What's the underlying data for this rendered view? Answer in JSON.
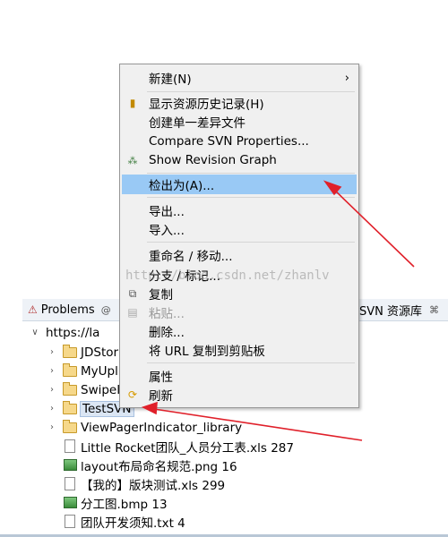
{
  "context_menu": {
    "items": [
      {
        "label": "新建(N)",
        "submenu": true
      },
      {
        "label": "显示资源历史记录(H)",
        "icon": "history-icon"
      },
      {
        "label": "创建单一差异文件"
      },
      {
        "label": "Compare SVN Properties..."
      },
      {
        "label": "Show Revision Graph",
        "icon": "revision-graph-icon"
      },
      {
        "label": "检出为(A)...",
        "highlighted": true
      },
      {
        "label": "导出..."
      },
      {
        "label": "导入..."
      },
      {
        "label": "重命名 / 移动..."
      },
      {
        "label": "分支 / 标记..."
      },
      {
        "label": "复制",
        "icon": "copy-icon"
      },
      {
        "label": "粘贴...",
        "icon": "paste-icon",
        "disabled": true
      },
      {
        "label": "删除..."
      },
      {
        "label": "将 URL 复制到剪贴板"
      },
      {
        "label": "属性"
      },
      {
        "label": "刷新",
        "icon": "refresh-icon"
      }
    ]
  },
  "panel": {
    "tabs": [
      {
        "label": "Problems",
        "icon": "problems-icon"
      },
      {
        "label": "SVN 资源库",
        "close": "⌘"
      }
    ],
    "problems_suffix": "@"
  },
  "tree": {
    "root": "https://la",
    "items": [
      {
        "label": "JDStor",
        "type": "folder"
      },
      {
        "label": "MyUpl",
        "type": "folder"
      },
      {
        "label": "SwipeI",
        "type": "folder"
      },
      {
        "label": "TestSVN",
        "type": "folder",
        "selected": true
      },
      {
        "label": "ViewPagerIndicator_library",
        "type": "folder"
      },
      {
        "label": "Little Rocket团队_人员分工表.xls 287",
        "type": "file"
      },
      {
        "label": "layout布局命名规范.png 16",
        "type": "image"
      },
      {
        "label": "【我的】版块测试.xls 299",
        "type": "file"
      },
      {
        "label": "分工图.bmp 13",
        "type": "image"
      },
      {
        "label": "团队开发须知.txt 4",
        "type": "file"
      }
    ]
  },
  "watermark": "http://blog.csdn.net/zhanlv",
  "colors": {
    "menu_bg": "#f0f0f0",
    "menu_highlight": "#99c9f5",
    "annotation_arrow": "#e0202a"
  }
}
